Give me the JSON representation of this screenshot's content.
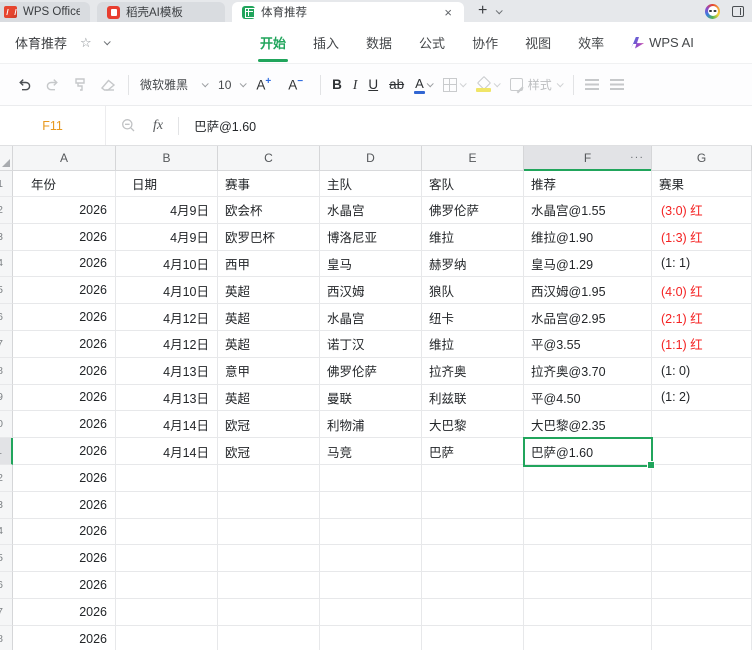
{
  "window": {
    "tabs": [
      {
        "label": "WPS Office"
      },
      {
        "label": "稻壳AI模板"
      },
      {
        "label": "体育推荐",
        "active": true
      }
    ]
  },
  "titlebar": {
    "doc_title": "体育推荐"
  },
  "ribbon": {
    "tabs": [
      {
        "label": "开始",
        "active": true
      },
      {
        "label": "插入"
      },
      {
        "label": "数据"
      },
      {
        "label": "公式"
      },
      {
        "label": "协作"
      },
      {
        "label": "视图"
      },
      {
        "label": "效率"
      },
      {
        "label": "WPS AI",
        "icon": "wps-ai"
      }
    ]
  },
  "toolbar": {
    "font_name": "微软雅黑",
    "font_size": "10",
    "bold": "B",
    "italic": "I",
    "underline": "U",
    "strikethrough": "ab",
    "font_color_letter": "A",
    "style_label": "样式"
  },
  "formula_bar": {
    "cell_ref": "F11",
    "fx_glyph": "fx",
    "value": "巴萨@1.60"
  },
  "icons": {
    "close": "×",
    "plus": "+",
    "star": "☆",
    "column_menu": "···"
  },
  "colors": {
    "accent_green": "#21a55c",
    "result_red": "#f42121",
    "cell_ref_orange": "#e8991f",
    "font_color_blue": "#3166d2",
    "fill_yellow": "#f0e568",
    "docer_red": "#e83e30"
  },
  "sheet": {
    "columns": [
      "A",
      "B",
      "C",
      "D",
      "E",
      "F",
      "G"
    ],
    "selected_column": "F",
    "selected_cell": "F11",
    "header_row": [
      "年份",
      "日期",
      "赛事",
      "主队",
      "客队",
      "推荐",
      "赛果"
    ],
    "rows": [
      {
        "year": "2026",
        "date": "4月9日",
        "comp": "欧会杯",
        "home": "水晶宫",
        "away": "佛罗伦萨",
        "rec": "水晶宫@1.55",
        "result": "(3:0) 红",
        "red": true
      },
      {
        "year": "2026",
        "date": "4月9日",
        "comp": "欧罗巴杯",
        "home": "博洛尼亚",
        "away": "维拉",
        "rec": "维拉@1.90",
        "result": "(1:3) 红",
        "red": true
      },
      {
        "year": "2026",
        "date": "4月10日",
        "comp": "西甲",
        "home": "皇马",
        "away": "赫罗纳",
        "rec": "皇马@1.29",
        "result": "(1: 1)",
        "red": false
      },
      {
        "year": "2026",
        "date": "4月10日",
        "comp": "英超",
        "home": "西汉姆",
        "away": "狼队",
        "rec": "西汉姆@1.95",
        "result": "(4:0) 红",
        "red": true
      },
      {
        "year": "2026",
        "date": "4月12日",
        "comp": "英超",
        "home": "水晶宫",
        "away": "纽卡",
        "rec": "水品宫@2.95",
        "result": "(2:1) 红",
        "red": true
      },
      {
        "year": "2026",
        "date": "4月12日",
        "comp": "英超",
        "home": "诺丁汉",
        "away": "维拉",
        "rec": "平@3.55",
        "result": "(1:1) 红",
        "red": true
      },
      {
        "year": "2026",
        "date": "4月13日",
        "comp": "意甲",
        "home": "佛罗伦萨",
        "away": "拉齐奥",
        "rec": "拉齐奥@3.70",
        "result": "(1: 0)",
        "red": false
      },
      {
        "year": "2026",
        "date": "4月13日",
        "comp": "英超",
        "home": "曼联",
        "away": "利兹联",
        "rec": "平@4.50",
        "result": "(1: 2)",
        "red": false
      },
      {
        "year": "2026",
        "date": "4月14日",
        "comp": "欧冠",
        "home": "利物浦",
        "away": "大巴黎",
        "rec": "大巴黎@2.35",
        "result": "",
        "red": false
      },
      {
        "year": "2026",
        "date": "4月14日",
        "comp": "欧冠",
        "home": "马竞",
        "away": "巴萨",
        "rec": "巴萨@1.60",
        "result": "",
        "red": false,
        "selected": true
      },
      {
        "year": "2026",
        "date": "",
        "comp": "",
        "home": "",
        "away": "",
        "rec": "",
        "result": "",
        "red": false
      },
      {
        "year": "2026",
        "date": "",
        "comp": "",
        "home": "",
        "away": "",
        "rec": "",
        "result": "",
        "red": false
      },
      {
        "year": "2026",
        "date": "",
        "comp": "",
        "home": "",
        "away": "",
        "rec": "",
        "result": "",
        "red": false
      },
      {
        "year": "2026",
        "date": "",
        "comp": "",
        "home": "",
        "away": "",
        "rec": "",
        "result": "",
        "red": false
      },
      {
        "year": "2026",
        "date": "",
        "comp": "",
        "home": "",
        "away": "",
        "rec": "",
        "result": "",
        "red": false
      },
      {
        "year": "2026",
        "date": "",
        "comp": "",
        "home": "",
        "away": "",
        "rec": "",
        "result": "",
        "red": false
      },
      {
        "year": "2026",
        "date": "",
        "comp": "",
        "home": "",
        "away": "",
        "rec": "",
        "result": "",
        "red": false
      }
    ]
  }
}
